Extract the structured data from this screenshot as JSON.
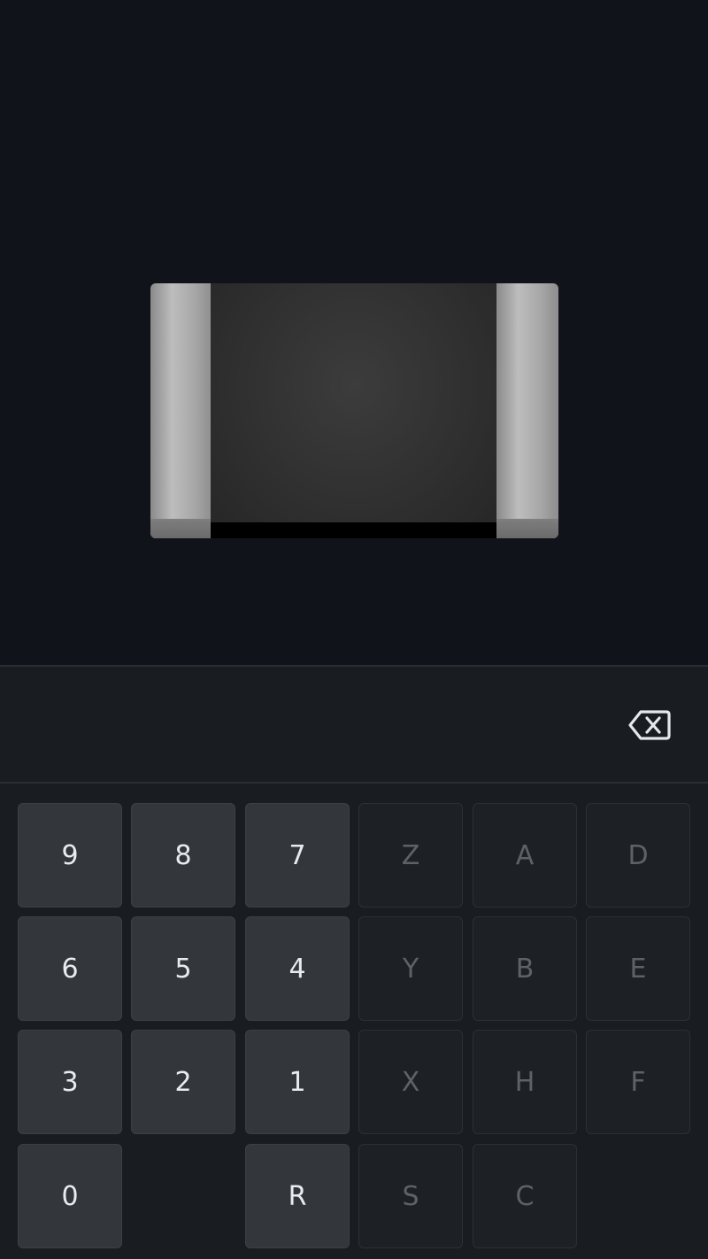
{
  "input": {
    "value": ""
  },
  "icons": {
    "backspace": "backspace-icon"
  },
  "colors": {
    "background": "#10141a",
    "panel": "#191d21",
    "key_active": "#33373c",
    "key_inactive": "#1d2125",
    "text_active": "#e9ebee",
    "text_inactive": "#5e6267"
  },
  "keypad": {
    "rows": [
      [
        {
          "label": "9",
          "enabled": true
        },
        {
          "label": "8",
          "enabled": true
        },
        {
          "label": "7",
          "enabled": true
        },
        {
          "label": "Z",
          "enabled": false
        },
        {
          "label": "A",
          "enabled": false
        },
        {
          "label": "D",
          "enabled": false
        }
      ],
      [
        {
          "label": "6",
          "enabled": true
        },
        {
          "label": "5",
          "enabled": true
        },
        {
          "label": "4",
          "enabled": true
        },
        {
          "label": "Y",
          "enabled": false
        },
        {
          "label": "B",
          "enabled": false
        },
        {
          "label": "E",
          "enabled": false
        }
      ],
      [
        {
          "label": "3",
          "enabled": true
        },
        {
          "label": "2",
          "enabled": true
        },
        {
          "label": "1",
          "enabled": true
        },
        {
          "label": "X",
          "enabled": false
        },
        {
          "label": "H",
          "enabled": false
        },
        {
          "label": "F",
          "enabled": false
        }
      ],
      [
        {
          "label": "0",
          "enabled": true
        },
        {
          "label": "R",
          "enabled": true
        },
        {
          "label": "S",
          "enabled": false
        },
        {
          "label": "C",
          "enabled": false
        }
      ]
    ]
  }
}
